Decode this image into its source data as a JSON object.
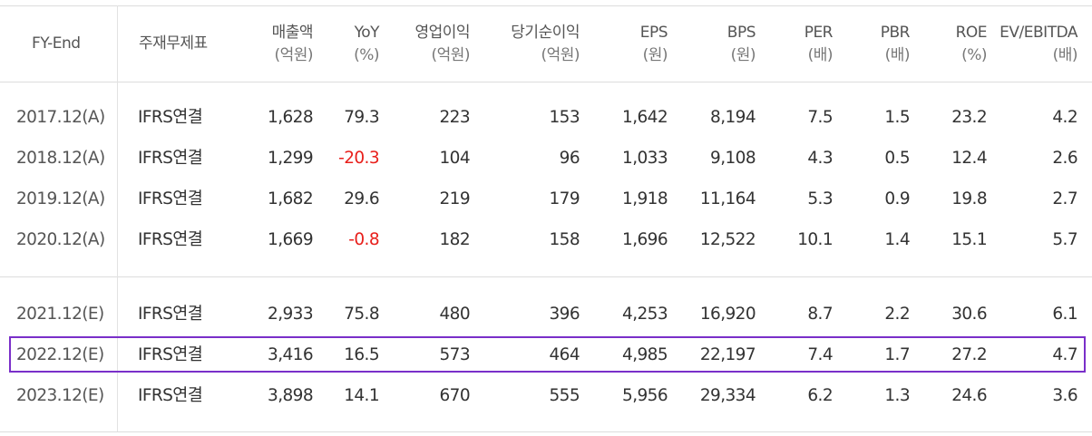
{
  "header": {
    "fy_end": "FY-End",
    "subject": "주재무제표",
    "columns": [
      {
        "key": "sales",
        "name": "매출액",
        "unit": "(억원)"
      },
      {
        "key": "yoy",
        "name": "YoY",
        "unit": "(%)"
      },
      {
        "key": "op_income",
        "name": "영업이익",
        "unit": "(억원)"
      },
      {
        "key": "net_income",
        "name": "당기순이익",
        "unit": "(억원)"
      },
      {
        "key": "eps",
        "name": "EPS",
        "unit": "(원)"
      },
      {
        "key": "bps",
        "name": "BPS",
        "unit": "(원)"
      },
      {
        "key": "per",
        "name": "PER",
        "unit": "(배)"
      },
      {
        "key": "pbr",
        "name": "PBR",
        "unit": "(배)"
      },
      {
        "key": "roe",
        "name": "ROE",
        "unit": "(%)"
      },
      {
        "key": "ev_ebitda",
        "name": "EV/EBITDA",
        "unit": "(배)"
      }
    ]
  },
  "rows": [
    {
      "period": "2017.12(A)",
      "basis": "IFRS연결",
      "values": [
        "1,628",
        "79.3",
        "223",
        "153",
        "1,642",
        "8,194",
        "7.5",
        "1.5",
        "23.2",
        "4.2"
      ],
      "yoy_negative": false,
      "highlighted": false
    },
    {
      "period": "2018.12(A)",
      "basis": "IFRS연결",
      "values": [
        "1,299",
        "-20.3",
        "104",
        "96",
        "1,033",
        "9,108",
        "4.3",
        "0.5",
        "12.4",
        "2.6"
      ],
      "yoy_negative": true,
      "highlighted": false
    },
    {
      "period": "2019.12(A)",
      "basis": "IFRS연결",
      "values": [
        "1,682",
        "29.6",
        "219",
        "179",
        "1,918",
        "11,164",
        "5.3",
        "0.9",
        "19.8",
        "2.7"
      ],
      "yoy_negative": false,
      "highlighted": false
    },
    {
      "period": "2020.12(A)",
      "basis": "IFRS연결",
      "values": [
        "1,669",
        "-0.8",
        "182",
        "158",
        "1,696",
        "12,522",
        "10.1",
        "1.4",
        "15.1",
        "5.7"
      ],
      "yoy_negative": true,
      "highlighted": false
    },
    {
      "period": "2021.12(E)",
      "basis": "IFRS연결",
      "values": [
        "2,933",
        "75.8",
        "480",
        "396",
        "4,253",
        "16,920",
        "8.7",
        "2.2",
        "30.6",
        "6.1"
      ],
      "yoy_negative": false,
      "highlighted": false
    },
    {
      "period": "2022.12(E)",
      "basis": "IFRS연결",
      "values": [
        "3,416",
        "16.5",
        "573",
        "464",
        "4,985",
        "22,197",
        "7.4",
        "1.7",
        "27.2",
        "4.7"
      ],
      "yoy_negative": false,
      "highlighted": true
    },
    {
      "period": "2023.12(E)",
      "basis": "IFRS연결",
      "values": [
        "3,898",
        "14.1",
        "670",
        "555",
        "5,956",
        "29,334",
        "6.2",
        "1.3",
        "24.6",
        "3.6"
      ],
      "yoy_negative": false,
      "highlighted": false
    }
  ],
  "colors": {
    "negative": "#e8201c",
    "highlight_border": "#7a2fc9",
    "grid_line": "#dddddd"
  }
}
